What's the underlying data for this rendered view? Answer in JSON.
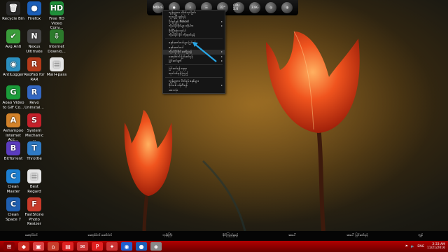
{
  "desktop": {
    "icons": [
      {
        "label": "Recycle Bin",
        "glyph": "🗑",
        "color": "#2a2a2a"
      },
      {
        "label": "Firefox",
        "glyph": "●",
        "color": "#1c5fb8"
      },
      {
        "label": "Free HD Video Conv...",
        "glyph": "HD",
        "color": "#1f8f3a"
      },
      {
        "label": "Avg Anti",
        "glyph": "✔",
        "color": "#3a9d3a"
      },
      {
        "label": "Nexus Ultimate",
        "glyph": "N",
        "color": "#444"
      },
      {
        "label": "Internet Downlo...",
        "glyph": "⇩",
        "color": "#2c7a2c"
      },
      {
        "label": "AntiLogger",
        "glyph": "◉",
        "color": "#2b8fbf"
      },
      {
        "label": "ReoFab for RAR",
        "glyph": "R",
        "color": "#b43a1a"
      },
      {
        "label": "Mail+pass",
        "glyph": "▤",
        "color": "#e5e5e5"
      },
      {
        "label": "Aoao Video to GIF Co...",
        "glyph": "G",
        "color": "#1a9c3a"
      },
      {
        "label": "Revo Uninstal...",
        "glyph": "R",
        "color": "#3367c2"
      },
      {
        "label": "Ashampoo Internet Acc...",
        "glyph": "A",
        "color": "#d2822a"
      },
      {
        "label": "System Mechanic ...",
        "glyph": "S",
        "color": "#c4202a"
      },
      {
        "label": "BitTorrent",
        "glyph": "B",
        "color": "#5b3cbf"
      },
      {
        "label": "Throttle",
        "glyph": "T",
        "color": "#2f7ac4"
      },
      {
        "label": "Clean Master",
        "glyph": "C",
        "color": "#1d7fd1"
      },
      {
        "label": "Best Regard",
        "glyph": "▤",
        "color": "#e5e5e5"
      },
      {
        "label": "Clean Space 7",
        "glyph": "C",
        "color": "#1f5fb0"
      },
      {
        "label": "FastStone Photo Resizer",
        "glyph": "F",
        "color": "#c93a2a"
      }
    ]
  },
  "dock": {
    "items": [
      "MOHS",
      "●",
      "⚡",
      "☰",
      "32°",
      "CPU 2.0",
      "3.8G",
      "◎",
      "◍"
    ]
  },
  "context_menu": {
    "items": [
      {
        "label": "ကွန်ပျူတာ လိုက်လုပ်ခြင်း",
        "arrow": ""
      },
      {
        "label": "ကူးယူပြီး ဖွင့်ရန်",
        "arrow": ""
      },
      {
        "label": "ပိုင်ရှင်ခွင့် Nokod",
        "arrow": "▸"
      },
      {
        "label": "ကိုယ်ပိုင်ဖိုင်များ လိုပါက",
        "arrow": "▸"
      },
      {
        "label": "ဖိုင်ပြီးဆုံး လုပ်ပါ",
        "arrow": ""
      },
      {
        "label": "ကိုယ်ပိုင် ဖိုင် ကိုထုတ်ရန်",
        "arrow": ""
      },
      {
        "label": "sep"
      },
      {
        "label": "စနစ်ဆက်တင်များ ပြင်ရန်",
        "arrow": ""
      },
      {
        "label": "စနစ်ဆက်တင်",
        "arrow": ""
      },
      {
        "label": "ကိုယ်ပိုင်ဖိုင် ဖော်ပြရန်",
        "arrow": "▸"
      },
      {
        "label": "ဆော့ဖ်ဝဲလ် ပြင်ဆင်ရန်",
        "arrow": "▸"
      },
      {
        "label": "ပြင်ဆင်ချက်",
        "arrow": "▸"
      },
      {
        "label": "sep"
      },
      {
        "label": "ပြင်ဆင်ရန် နေရာ",
        "arrow": ""
      },
      {
        "label": "ထုတ်ပစ်ရန် ကြည့်",
        "arrow": ""
      },
      {
        "label": "sep"
      },
      {
        "label": "ကွန်ပျူတာ ပိတ်ရန် စနစ်များ",
        "arrow": ""
      },
      {
        "label": "ဖိုင်သစ် ဖန်တီးရန်",
        "arrow": "▸"
      },
      {
        "label": "အား လုံး",
        "arrow": ""
      }
    ]
  },
  "shellbar": {
    "items": [
      "ဆော့ဝ်ဝဲလ်",
      "ဆော့ဖ်ဝဲလ် ဆော်ဝဲလ်",
      "ဘုန်းကြီး",
      "ဖိုင်ကြည့်ရှုရန်",
      "အပေါ်",
      "အပေါ် ပြင်ဆင်ရန်",
      "ကွန်"
    ]
  },
  "taskbar": {
    "buttons": [
      {
        "glyph": "⊞",
        "color": "#8a0000"
      },
      {
        "glyph": "◆",
        "color": "#c92a1f"
      },
      {
        "glyph": "▣",
        "color": "#d44"
      },
      {
        "glyph": "⌂",
        "color": "#c83c2a"
      },
      {
        "glyph": "▤",
        "color": "#d22"
      },
      {
        "glyph": "✉",
        "color": "#c33"
      },
      {
        "glyph": "P",
        "color": "#e02020"
      },
      {
        "glyph": "✦",
        "color": "#c33"
      },
      {
        "glyph": "◉",
        "color": "#1e5fd0"
      },
      {
        "glyph": "●",
        "color": "#1c5fb8"
      },
      {
        "glyph": "◈",
        "color": "#888"
      }
    ],
    "lang": "ENG",
    "time": "2:33 AM",
    "date": "11/21/2016"
  }
}
